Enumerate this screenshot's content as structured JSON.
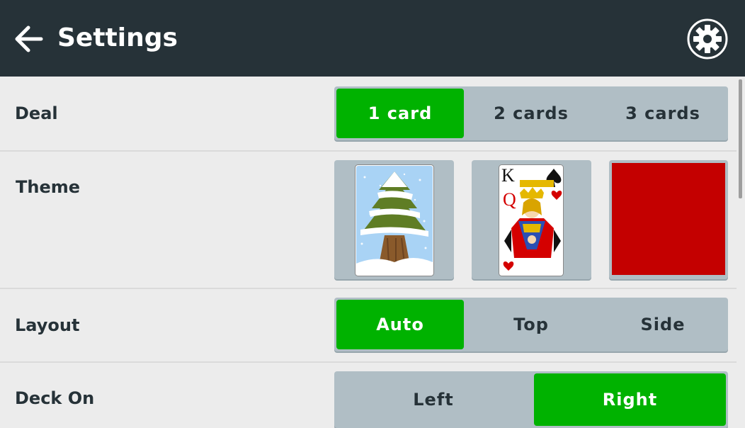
{
  "header": {
    "title": "Settings",
    "back_icon": "arrow-left-icon",
    "settings_icon": "gear-icon",
    "background": "#263238"
  },
  "accent_color": "#00b200",
  "settings": {
    "deal": {
      "label": "Deal",
      "options": [
        "1 card",
        "2 cards",
        "3 cards"
      ],
      "selected": "1 card"
    },
    "theme": {
      "label": "Theme",
      "options": [
        "snowy-tree-card-back",
        "king-queen-card-face",
        "solid-red-card-back"
      ],
      "solid_color": "#c40000"
    },
    "layout": {
      "label": "Layout",
      "options": [
        "Auto",
        "Top",
        "Side"
      ],
      "selected": "Auto"
    },
    "deck_on": {
      "label": "Deck On",
      "options": [
        "Left",
        "Right"
      ],
      "selected": "Right"
    }
  }
}
